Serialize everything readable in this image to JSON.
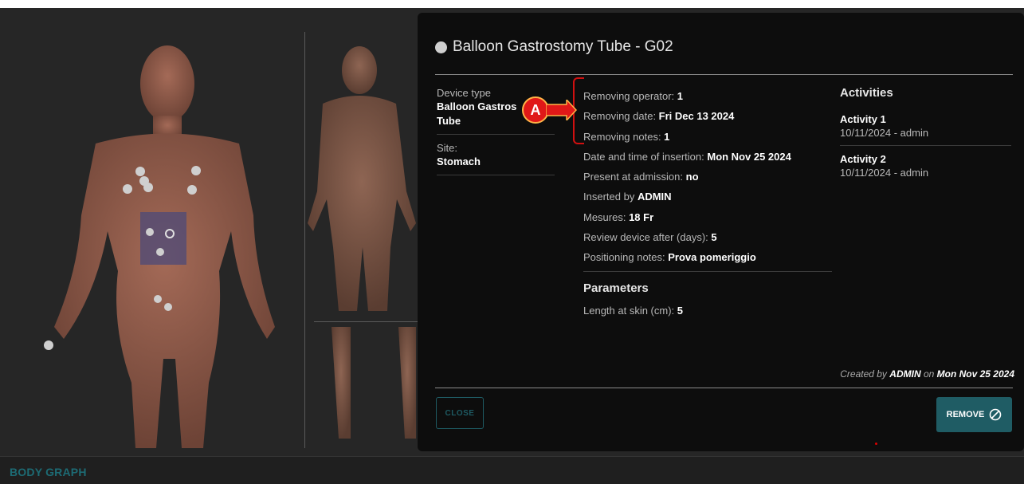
{
  "bottom_bar": {
    "label": "BODY GRAPH"
  },
  "modal": {
    "title": "Balloon Gastrostomy Tube - G02",
    "left": {
      "device_type_label": "Device type",
      "device_type_value_line1": "Balloon Gastros",
      "device_type_value_line2": "Tube",
      "site_label": "Site:",
      "site_value": "Stomach"
    },
    "details": [
      {
        "label": "Removing operator: ",
        "value": "1"
      },
      {
        "label": "Removing date: ",
        "value": "Fri Dec 13 2024"
      },
      {
        "label": "Removing notes: ",
        "value": "1"
      },
      {
        "label": "Date and time of insertion: ",
        "value": "Mon Nov 25 2024"
      },
      {
        "label": "Present at admission: ",
        "value": "no"
      },
      {
        "label": "Inserted by ",
        "value": "ADMIN"
      },
      {
        "label": "Mesures: ",
        "value": "18 Fr"
      },
      {
        "label": "Review device after (days): ",
        "value": "5"
      },
      {
        "label": "Positioning notes: ",
        "value": "Prova pomeriggio"
      }
    ],
    "parameters": {
      "heading": "Parameters",
      "items": [
        {
          "label": "Length at skin (cm): ",
          "value": "5"
        }
      ]
    },
    "activities": {
      "heading": "Activities",
      "items": [
        {
          "name": "Activity 1",
          "meta": "10/11/2024 - admin"
        },
        {
          "name": "Activity 2",
          "meta": "10/11/2024 - admin"
        }
      ]
    },
    "created": {
      "prefix": "Created by ",
      "user": "ADMIN",
      "mid": " on ",
      "date": "Mon Nov 25 2024"
    },
    "buttons": {
      "close": "CLOSE",
      "remove": "REMOVE"
    }
  },
  "callout": {
    "letter": "A"
  }
}
